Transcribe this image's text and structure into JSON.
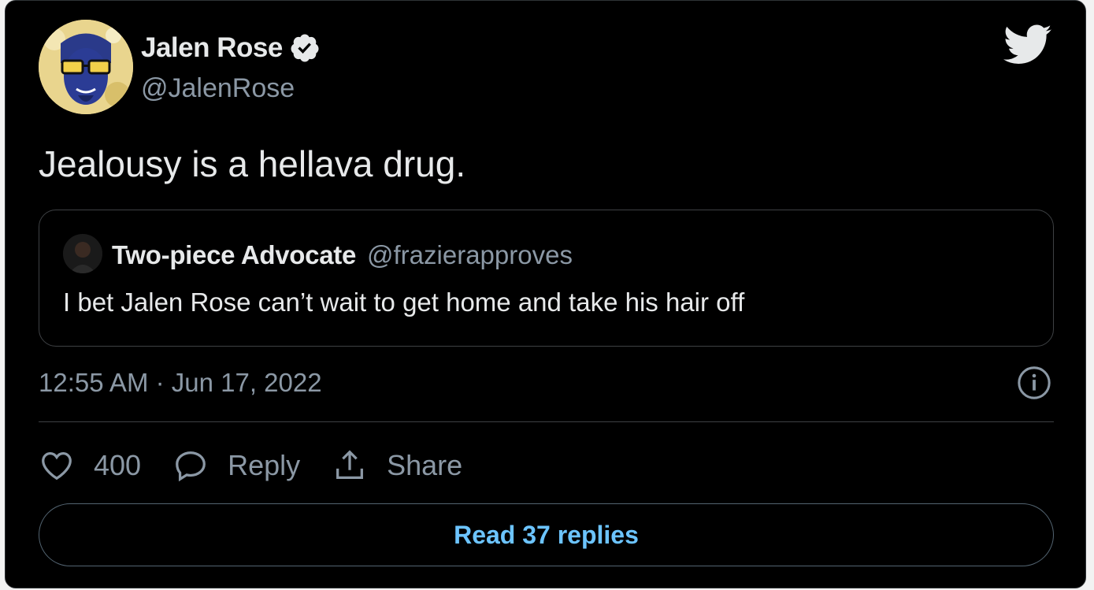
{
  "tweet": {
    "author": {
      "name": "Jalen Rose",
      "handle": "@JalenRose",
      "verified": true
    },
    "text": "Jealousy is a hellava drug.",
    "quote": {
      "name": "Two-piece Advocate",
      "handle": "@frazierapproves",
      "text": "I bet Jalen Rose can’t wait to get home and take his hair off"
    },
    "timestamp": "12:55 AM · Jun 17, 2022",
    "actions": {
      "like_count": "400",
      "reply_label": "Reply",
      "share_label": "Share"
    },
    "read_replies_label": "Read 37 replies"
  },
  "colors": {
    "background": "#000000",
    "text_primary": "#e7e9ea",
    "text_secondary": "#8b98a5",
    "accent": "#6cc4ff",
    "border": "#3e4144"
  },
  "icons": [
    "twitter-bird-icon",
    "verified-badge-icon",
    "info-icon",
    "heart-icon",
    "reply-bubble-icon",
    "share-icon"
  ]
}
